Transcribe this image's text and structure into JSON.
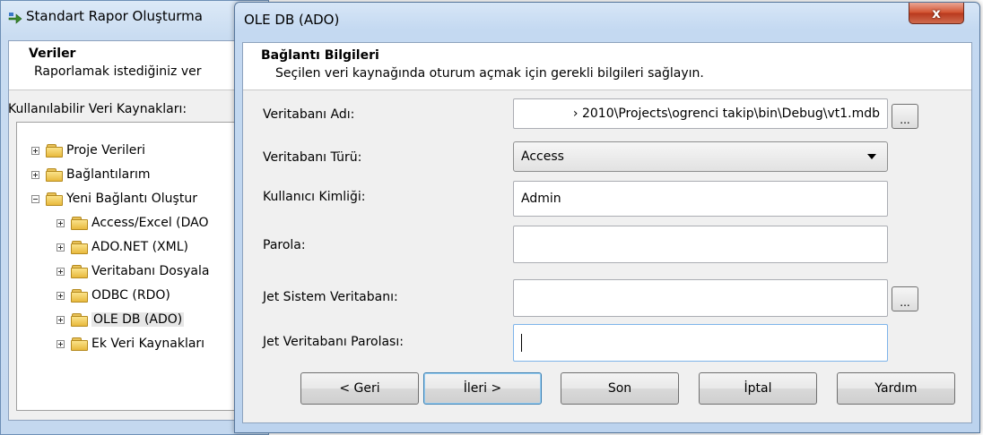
{
  "background_window": {
    "title": "Standart Rapor Oluşturma",
    "header_title": "Veriler",
    "header_subtitle": "Raporlamak istediğiniz ver",
    "sources_label": "Kullanılabilir Veri Kaynakları:",
    "tree": [
      {
        "label": "Proje Verileri",
        "expander": "plus"
      },
      {
        "label": "Bağlantılarım",
        "expander": "plus"
      },
      {
        "label": "Yeni Bağlantı Oluştur",
        "expander": "minus"
      },
      {
        "label": "Access/Excel (DAO",
        "expander": "plus"
      },
      {
        "label": "ADO.NET (XML)",
        "expander": "plus"
      },
      {
        "label": "Veritabanı Dosyala",
        "expander": "plus"
      },
      {
        "label": "ODBC (RDO)",
        "expander": "plus"
      },
      {
        "label": "OLE DB (ADO)",
        "expander": "plus",
        "selected": true
      },
      {
        "label": "Ek Veri Kaynakları",
        "expander": "plus"
      }
    ]
  },
  "dialog": {
    "title": "OLE DB (ADO)",
    "close_label": "x",
    "header_title": "Bağlantı Bilgileri",
    "header_subtitle": "Seçilen veri kaynağında oturum açmak için gerekli bilgileri sağlayın.",
    "fields": {
      "database_name": {
        "label": "Veritabanı Adı:",
        "value": "› 2010\\Projects\\ogrenci takip\\bin\\Debug\\vt1.mdb"
      },
      "database_type": {
        "label": "Veritabanı Türü:",
        "value": "Access"
      },
      "user_id": {
        "label": "Kullanıcı Kimliği:",
        "value": "Admin"
      },
      "password": {
        "label": "Parola:",
        "value": ""
      },
      "jet_system_db": {
        "label": "Jet Sistem Veritabanı:",
        "value": ""
      },
      "jet_db_password": {
        "label": "Jet Veritabanı Parolası:",
        "value": ""
      }
    },
    "browse_label": "...",
    "buttons": {
      "back": "< Geri",
      "next": "İleri >",
      "finish": "Son",
      "cancel": "İptal",
      "help": "Yardım"
    }
  }
}
